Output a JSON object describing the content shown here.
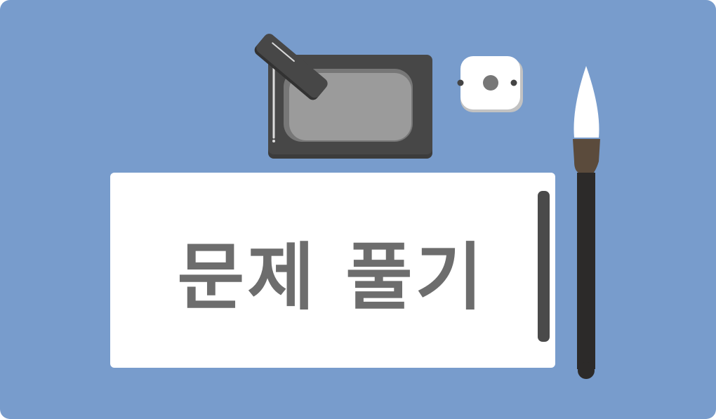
{
  "title": "문제 풀기",
  "colors": {
    "background": "#789ccc",
    "paper": "#ffffff",
    "text": "#6d6d6d",
    "inkstone": "#474747",
    "ink_well": "#9b9b9b",
    "brush_handle": "#2c2a29",
    "brush_ferrule": "#5b4b3c",
    "brush_tip": "#ffffff"
  },
  "icons": [
    "inkstone-icon",
    "ink-stick-icon",
    "water-dropper-icon",
    "brush-icon",
    "scroll-roller-icon"
  ]
}
